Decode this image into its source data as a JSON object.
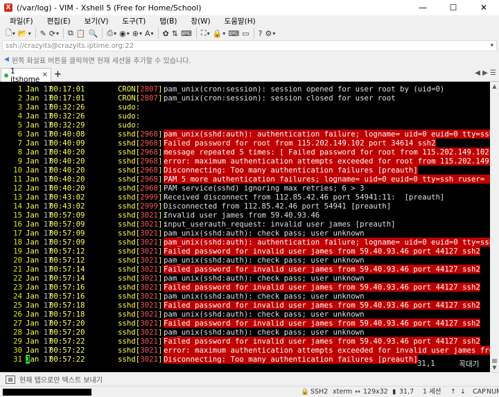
{
  "window": {
    "title": "(/var/log) - VIM - Xshell 5 (Free for Home/School)",
    "minimize": "—",
    "maximize": "☐",
    "close": "✕"
  },
  "menu": [
    "파일(F)",
    "편집(E)",
    "보기(V)",
    "도구(T)",
    "탭(B)",
    "창(W)",
    "도움말(H)"
  ],
  "address": {
    "value": "ssh://crazyits@crazyits.iptime.org:22"
  },
  "hint": "왼쪽 화살표 버튼을 클릭하면 현재 세션을 추가할 수 있습니다.",
  "tabs": [
    {
      "label": "1 itshome"
    }
  ],
  "newtab": "+",
  "colors": {
    "error_bg": "#c00000",
    "line_number": "#e6e600",
    "pid": "#ff5555",
    "cursor": "#3cc93c"
  },
  "log": [
    {
      "n": "1",
      "mon": "Jan",
      "day": "17",
      "time": "00:17:01",
      "proc": "CRON",
      "pid": "2807",
      "msg": "pam_unix(cron:session): session opened for user root by (uid=0)",
      "err": false
    },
    {
      "n": "2",
      "mon": "Jan",
      "day": "17",
      "time": "00:17:01",
      "proc": "CRON",
      "pid": "2807",
      "msg": "pam_unix(cron:session): session closed for user root",
      "err": false
    },
    {
      "n": "3",
      "mon": "Jan",
      "day": "17",
      "time": "00:32:26",
      "proc": "sudo:",
      "pid": "",
      "msg": "",
      "err": false
    },
    {
      "n": "4",
      "mon": "Jan",
      "day": "17",
      "time": "00:32:26",
      "proc": "sudo:",
      "pid": "",
      "msg": "",
      "err": false
    },
    {
      "n": "5",
      "mon": "Jan",
      "day": "17",
      "time": "00:32:29",
      "proc": "sudo:",
      "pid": "",
      "msg": "",
      "err": false
    },
    {
      "n": "6",
      "mon": "Jan",
      "day": "17",
      "time": "00:40:08",
      "proc": "sshd",
      "pid": "2968",
      "msg": "pam_unix(sshd:auth): authentication failure; logname= uid=0 euid=0 tty=ssh ruser= rhos",
      "err": true
    },
    {
      "n": "7",
      "mon": "Jan",
      "day": "17",
      "time": "00:40:09",
      "proc": "sshd",
      "pid": "2968",
      "msg": "Failed password for root from 115.202.149.102 port 34614 ssh2",
      "err": true
    },
    {
      "n": "8",
      "mon": "Jan",
      "day": "17",
      "time": "00:40:20",
      "proc": "sshd",
      "pid": "2968",
      "msg": "message repeated 5 times: [ Failed password for root from 115.202.149.102 port 34614 s",
      "err": true
    },
    {
      "n": "9",
      "mon": "Jan",
      "day": "17",
      "time": "00:40:20",
      "proc": "sshd",
      "pid": "2968",
      "msg": "error: maximum authentication attempts exceeded for root from 115.202.149.102 port 346",
      "err": true
    },
    {
      "n": "10",
      "mon": "Jan",
      "day": "17",
      "time": "00:40:20",
      "proc": "sshd",
      "pid": "2968",
      "msg": "Disconnecting: Too many authentication failures [preauth]",
      "err": true
    },
    {
      "n": "11",
      "mon": "Jan",
      "day": "17",
      "time": "00:40:20",
      "proc": "sshd",
      "pid": "2968",
      "msg": "PAM 5 more authentication failures; logname= uid=0 euid=0 tty=ssh ruser= rhost=115.202",
      "err": true
    },
    {
      "n": "12",
      "mon": "Jan",
      "day": "17",
      "time": "00:40:20",
      "proc": "sshd",
      "pid": "2968",
      "msg": "PAM service(sshd) ignoring max retries; 6 > 3",
      "err": false
    },
    {
      "n": "13",
      "mon": "Jan",
      "day": "17",
      "time": "00:43:02",
      "proc": "sshd",
      "pid": "2999",
      "msg": "Received disconnect from 112.85.42.46 port 54941:11:  [preauth]",
      "err": false
    },
    {
      "n": "14",
      "mon": "Jan",
      "day": "17",
      "time": "00:43:02",
      "proc": "sshd",
      "pid": "2999",
      "msg": "Disconnected from 112.85.42.46 port 54941 [preauth]",
      "err": false
    },
    {
      "n": "15",
      "mon": "Jan",
      "day": "17",
      "time": "00:57:09",
      "proc": "sshd",
      "pid": "3021",
      "msg": "Invalid user james from 59.40.93.46",
      "err": false
    },
    {
      "n": "16",
      "mon": "Jan",
      "day": "17",
      "time": "00:57:09",
      "proc": "sshd",
      "pid": "3021",
      "msg": "input_userauth_request: invalid user james [preauth]",
      "err": false
    },
    {
      "n": "17",
      "mon": "Jan",
      "day": "17",
      "time": "00:57:09",
      "proc": "sshd",
      "pid": "3021",
      "msg": "pam_unix(sshd:auth): check pass; user unknown",
      "err": false
    },
    {
      "n": "18",
      "mon": "Jan",
      "day": "17",
      "time": "00:57:09",
      "proc": "sshd",
      "pid": "3021",
      "msg": "pam_unix(sshd:auth): authentication failure; logname= uid=0 euid=0 tty=ssh ruser= rhos",
      "err": true
    },
    {
      "n": "19",
      "mon": "Jan",
      "day": "17",
      "time": "00:57:12",
      "proc": "sshd",
      "pid": "3021",
      "msg": "Failed password for invalid user james from 59.40.93.46 port 44127 ssh2",
      "err": true
    },
    {
      "n": "20",
      "mon": "Jan",
      "day": "17",
      "time": "00:57:12",
      "proc": "sshd",
      "pid": "3021",
      "msg": "pam_unix(sshd:auth): check pass; user unknown",
      "err": false
    },
    {
      "n": "21",
      "mon": "Jan",
      "day": "17",
      "time": "00:57:14",
      "proc": "sshd",
      "pid": "3021",
      "msg": "Failed password for invalid user james from 59.40.93.46 port 44127 ssh2",
      "err": true
    },
    {
      "n": "22",
      "mon": "Jan",
      "day": "17",
      "time": "00:57:14",
      "proc": "sshd",
      "pid": "3021",
      "msg": "pam_unix(sshd:auth): check pass; user unknown",
      "err": false
    },
    {
      "n": "23",
      "mon": "Jan",
      "day": "17",
      "time": "00:57:16",
      "proc": "sshd",
      "pid": "3021",
      "msg": "Failed password for invalid user james from 59.40.93.46 port 44127 ssh2",
      "err": true
    },
    {
      "n": "24",
      "mon": "Jan",
      "day": "17",
      "time": "00:57:16",
      "proc": "sshd",
      "pid": "3021",
      "msg": "pam_unix(sshd:auth): check pass; user unknown",
      "err": false
    },
    {
      "n": "25",
      "mon": "Jan",
      "day": "17",
      "time": "00:57:18",
      "proc": "sshd",
      "pid": "3021",
      "msg": "Failed password for invalid user james from 59.40.93.46 port 44127 ssh2",
      "err": true
    },
    {
      "n": "26",
      "mon": "Jan",
      "day": "17",
      "time": "00:57:18",
      "proc": "sshd",
      "pid": "3021",
      "msg": "pam_unix(sshd:auth): check pass; user unknown",
      "err": false
    },
    {
      "n": "27",
      "mon": "Jan",
      "day": "17",
      "time": "00:57:20",
      "proc": "sshd",
      "pid": "3021",
      "msg": "Failed password for invalid user james from 59.40.93.46 port 44127 ssh2",
      "err": true
    },
    {
      "n": "28",
      "mon": "Jan",
      "day": "17",
      "time": "00:57:20",
      "proc": "sshd",
      "pid": "3021",
      "msg": "pam_unix(sshd:auth): check pass; user unknown",
      "err": false
    },
    {
      "n": "29",
      "mon": "Jan",
      "day": "17",
      "time": "00:57:22",
      "proc": "sshd",
      "pid": "3021",
      "msg": "Failed password for invalid user james from 59.40.93.46 port 44127 ssh2",
      "err": true
    },
    {
      "n": "30",
      "mon": "Jan",
      "day": "17",
      "time": "00:57:22",
      "proc": "sshd",
      "pid": "3021",
      "msg": "error: maximum authentication attempts exceeded for invalid user james from 59.40.93.4",
      "err": true
    },
    {
      "n": "31",
      "mon": "Jan",
      "day": "17",
      "time": "00:57:22",
      "proc": "sshd",
      "pid": "3021",
      "msg": "Disconnecting: Too many authentication failures [preauth]",
      "err": true
    }
  ],
  "vim_status": {
    "position": "31,1",
    "scroll": "꼭대기"
  },
  "sendbar": {
    "text": "현재 탭으로만 텍스트 보내기"
  },
  "statusbar": {
    "protocol": "SSH2",
    "term": "xterm",
    "size": "129x32",
    "cursor": "31,7",
    "sessions": "1 세션"
  }
}
